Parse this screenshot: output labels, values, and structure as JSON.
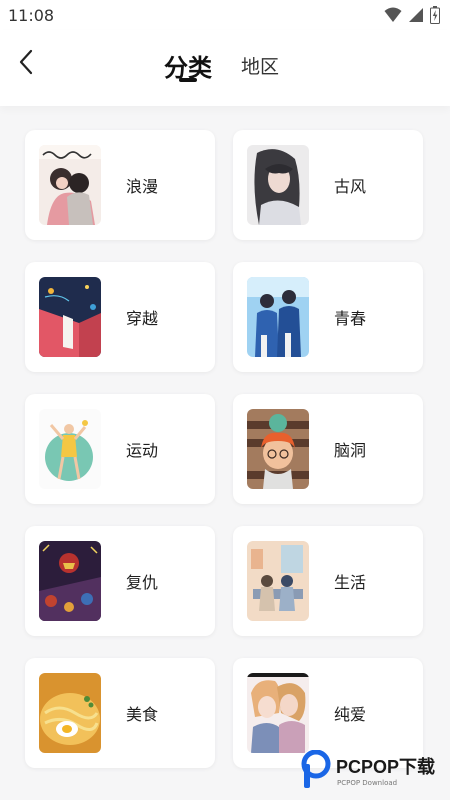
{
  "status_bar": {
    "time": "11:08"
  },
  "header": {
    "tabs": [
      {
        "label": "分类",
        "active": true
      },
      {
        "label": "地区",
        "active": false
      }
    ]
  },
  "categories": [
    {
      "label": "浪漫",
      "icon": "romance-cover-image"
    },
    {
      "label": "古风",
      "icon": "ancient-style-cover-image"
    },
    {
      "label": "穿越",
      "icon": "time-travel-cover-image"
    },
    {
      "label": "青春",
      "icon": "youth-cover-image"
    },
    {
      "label": "运动",
      "icon": "sports-cover-image"
    },
    {
      "label": "脑洞",
      "icon": "imagination-cover-image"
    },
    {
      "label": "复仇",
      "icon": "revenge-cover-image"
    },
    {
      "label": "生活",
      "icon": "life-cover-image"
    },
    {
      "label": "美食",
      "icon": "food-cover-image"
    },
    {
      "label": "纯爱",
      "icon": "pure-love-cover-image"
    }
  ],
  "watermark": {
    "text": "PCPOP下载",
    "subtext": "PCPOP Download"
  },
  "colors": {
    "background": "#f6f6f7",
    "card": "#ffffff",
    "accent": "#1a66e6"
  }
}
